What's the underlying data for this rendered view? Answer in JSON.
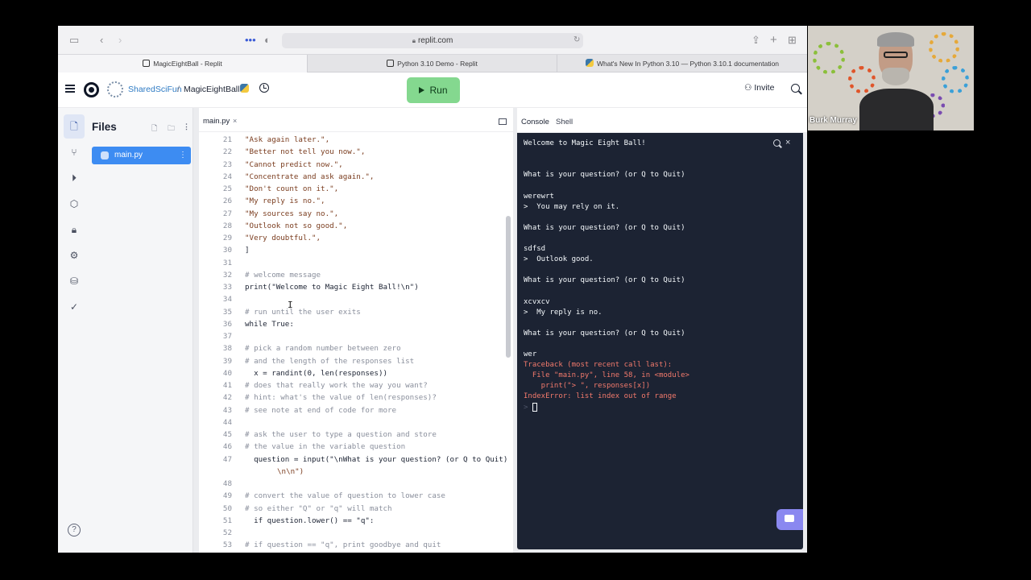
{
  "browser": {
    "url": "replit.com",
    "tabs": [
      {
        "title": "MagicEightBall - Replit"
      },
      {
        "title": "Python 3.10 Demo - Replit"
      },
      {
        "title": "What's New In Python 3.10 — Python 3.10.1 documentation"
      }
    ]
  },
  "header": {
    "team": "SharedSciFun",
    "separator": "/",
    "repl_name": "MagicEightBall",
    "run_label": "Run",
    "invite_label": "Invite"
  },
  "files": {
    "title": "Files",
    "items": [
      {
        "name": "main.py"
      }
    ]
  },
  "editor": {
    "tab_label": "main.py",
    "tab_close": "×",
    "lines": [
      {
        "n": "21",
        "text": "\"Ask again later.\",",
        "kind": "str"
      },
      {
        "n": "22",
        "text": "\"Better not tell you now.\",",
        "kind": "str"
      },
      {
        "n": "23",
        "text": "\"Cannot predict now.\",",
        "kind": "str"
      },
      {
        "n": "24",
        "text": "\"Concentrate and ask again.\",",
        "kind": "str"
      },
      {
        "n": "25",
        "text": "\"Don't count on it.\",",
        "kind": "str"
      },
      {
        "n": "26",
        "text": "\"My reply is no.\",",
        "kind": "str"
      },
      {
        "n": "27",
        "text": "\"My sources say no.\",",
        "kind": "str"
      },
      {
        "n": "28",
        "text": "\"Outlook not so good.\",",
        "kind": "str"
      },
      {
        "n": "29",
        "text": "\"Very doubtful.\",",
        "kind": "str"
      },
      {
        "n": "30",
        "text": "]",
        "kind": "code"
      },
      {
        "n": "31",
        "text": "",
        "kind": "code"
      },
      {
        "n": "32",
        "text": "# welcome message",
        "kind": "cmt"
      },
      {
        "n": "33",
        "text": "print(\"Welcome to Magic Eight Ball!\\n\")",
        "kind": "code"
      },
      {
        "n": "34",
        "text": "",
        "kind": "code"
      },
      {
        "n": "35",
        "text": "# run until the user exits",
        "kind": "cmt"
      },
      {
        "n": "36",
        "text": "while True:",
        "kind": "code"
      },
      {
        "n": "37",
        "text": "",
        "kind": "code"
      },
      {
        "n": "38",
        "text": "# pick a random number between zero",
        "kind": "cmt"
      },
      {
        "n": "39",
        "text": "# and the length of the responses list",
        "kind": "cmt"
      },
      {
        "n": "40",
        "text": "  x = randint(0, len(responses))",
        "kind": "code"
      },
      {
        "n": "41",
        "text": "# does that really work the way you want?",
        "kind": "cmt"
      },
      {
        "n": "42",
        "text": "# hint: what's the value of len(responses)?",
        "kind": "cmt"
      },
      {
        "n": "43",
        "text": "# see note at end of code for more",
        "kind": "cmt"
      },
      {
        "n": "44",
        "text": "",
        "kind": "code"
      },
      {
        "n": "45",
        "text": "# ask the user to type a question and store",
        "kind": "cmt"
      },
      {
        "n": "46",
        "text": "# the value in the variable question",
        "kind": "cmt"
      },
      {
        "n": "47",
        "text": "  question = input(\"\\nWhat is your question? (or Q to Quit)",
        "kind": "code"
      },
      {
        "n": "",
        "text": "\\n\\n\")",
        "kind": "cont"
      },
      {
        "n": "48",
        "text": "",
        "kind": "code"
      },
      {
        "n": "49",
        "text": "# convert the value of question to lower case",
        "kind": "cmt"
      },
      {
        "n": "50",
        "text": "# so either \"Q\" or \"q\" will match",
        "kind": "cmt"
      },
      {
        "n": "51",
        "text": "  if question.lower() == \"q\":",
        "kind": "code"
      },
      {
        "n": "52",
        "text": "",
        "kind": "code"
      },
      {
        "n": "53",
        "text": "# if question == \"q\", print goodbye and quit",
        "kind": "cmt"
      }
    ]
  },
  "console": {
    "tab_console": "Console",
    "tab_shell": "Shell",
    "lines": [
      {
        "text": "Welcome to Magic Eight Ball!",
        "kind": "out"
      },
      {
        "text": "",
        "kind": "out"
      },
      {
        "text": "",
        "kind": "out"
      },
      {
        "text": "What is your question? (or Q to Quit)",
        "kind": "out"
      },
      {
        "text": "",
        "kind": "out"
      },
      {
        "text": "werewrt",
        "kind": "out"
      },
      {
        "text": ">  You may rely on it.",
        "kind": "out"
      },
      {
        "text": "",
        "kind": "out"
      },
      {
        "text": "What is your question? (or Q to Quit)",
        "kind": "out"
      },
      {
        "text": "",
        "kind": "out"
      },
      {
        "text": "sdfsd",
        "kind": "out"
      },
      {
        "text": ">  Outlook good.",
        "kind": "out"
      },
      {
        "text": "",
        "kind": "out"
      },
      {
        "text": "What is your question? (or Q to Quit)",
        "kind": "out"
      },
      {
        "text": "",
        "kind": "out"
      },
      {
        "text": "xcvxcv",
        "kind": "out"
      },
      {
        "text": ">  My reply is no.",
        "kind": "out"
      },
      {
        "text": "",
        "kind": "out"
      },
      {
        "text": "What is your question? (or Q to Quit)",
        "kind": "out"
      },
      {
        "text": "",
        "kind": "out"
      },
      {
        "text": "wer",
        "kind": "out"
      },
      {
        "text": "Traceback (most recent call last):",
        "kind": "err"
      },
      {
        "text": "  File \"main.py\", line 58, in <module>",
        "kind": "err"
      },
      {
        "text": "    print(\"> \", responses[x])",
        "kind": "err"
      },
      {
        "text": "IndexError: list index out of range",
        "kind": "err"
      },
      {
        "text": ">",
        "kind": "prompt"
      }
    ]
  },
  "webcam": {
    "name": "Burk Murray"
  },
  "colors": {
    "run_button": "#84d88f",
    "console_bg": "#1c2333",
    "error_text": "#f37a6c",
    "file_selected": "#3d8cf2"
  }
}
